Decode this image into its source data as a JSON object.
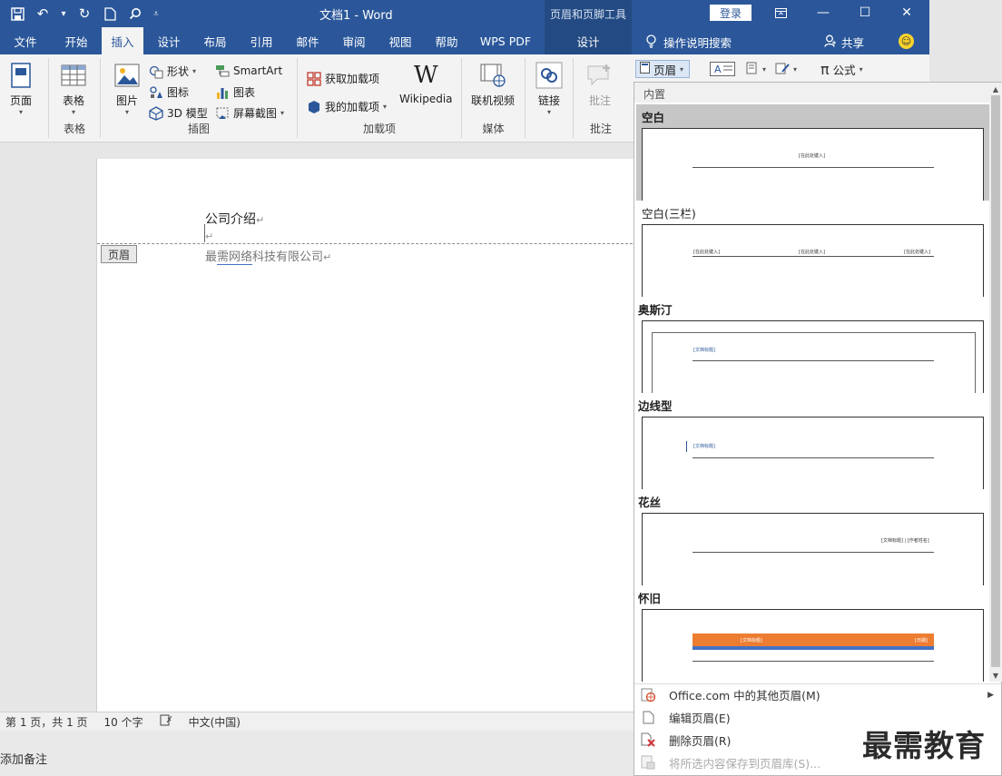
{
  "app": {
    "doc_title": "文档1  -  Word",
    "context_tab_title": "页眉和页脚工具",
    "login_label": "登录"
  },
  "tabs": [
    "文件",
    "开始",
    "插入",
    "设计",
    "布局",
    "引用",
    "邮件",
    "审阅",
    "视图",
    "帮助",
    "WPS PDF"
  ],
  "context_tab": "设计",
  "tell_me": "操作说明搜索",
  "share": "共享",
  "ribbon": {
    "pages": {
      "label": "页面",
      "group": ""
    },
    "tables": {
      "label": "表格",
      "group": "表格"
    },
    "illustrations": {
      "picture": "图片",
      "shapes": "形状",
      "icons": "图标",
      "model3d": "3D 模型",
      "smartart": "SmartArt",
      "chart": "图表",
      "screenshot": "屏幕截图",
      "group": "插图"
    },
    "addins": {
      "get": "获取加载项",
      "my": "我的加载项",
      "wikipedia": "Wikipedia",
      "group": "加载项"
    },
    "media": {
      "video": "联机视频",
      "group": "媒体"
    },
    "links": {
      "link": "链接",
      "group": ""
    },
    "comments": {
      "comment": "批注",
      "group": "批注"
    },
    "header_btn": "页眉",
    "formula": "公式"
  },
  "document": {
    "title": "公司介绍",
    "header_tag": "页眉",
    "company_part1": "最",
    "company_ul": "需网络",
    "company_part2": "科技有限公司",
    "return_mark": "↵"
  },
  "status": {
    "page": "第 1 页，共 1 页",
    "words": "10 个字",
    "language": "中文(中国)",
    "add_note": "添加备注"
  },
  "gallery": {
    "section": "内置",
    "items": [
      {
        "name": "空白",
        "t1": "[在此处键入]"
      },
      {
        "name": "空白(三栏)",
        "t1": "[在此处键入]",
        "t2": "[在此处键入]",
        "t3": "[在此处键入]"
      },
      {
        "name": "奥斯汀",
        "t1": "[文档标题]"
      },
      {
        "name": "边线型",
        "t1": "[文档标题]"
      },
      {
        "name": "花丝",
        "t1": "[文档标题] | [作者姓名]"
      },
      {
        "name": "怀旧",
        "t1": "[文档标题]",
        "t2": "[日期]"
      }
    ],
    "menu": [
      {
        "label": "Office.com 中的其他页眉(M)"
      },
      {
        "label": "编辑页眉(E)"
      },
      {
        "label": "删除页眉(R)"
      },
      {
        "label": "将所选内容保存到页眉库(S)..."
      }
    ]
  },
  "watermark": "最需教育",
  "colors": {
    "accent": "#2b579a",
    "vintage_orange": "#ed7d31",
    "vintage_blue": "#4472c4"
  }
}
